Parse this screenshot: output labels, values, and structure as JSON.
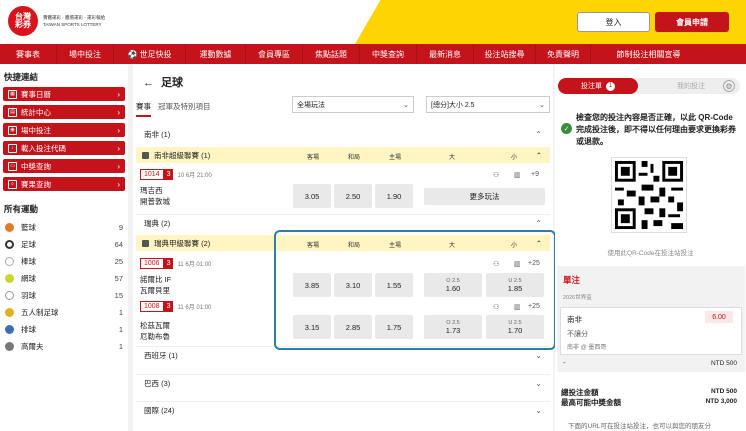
{
  "header": {
    "logo_mark": "台灣\n彩券",
    "logo_lines": [
      "實體運彩 · 體壇運彩 · 運彩報給",
      "TAIWAN SPORTS LOTTERY"
    ],
    "login_label": "登入",
    "register_label": "會員申請"
  },
  "nav": [
    "賽事表",
    "場中投注",
    "世足快投",
    "運動數據",
    "會員專區",
    "焦點話題",
    "中獎查詢",
    "最新消息",
    "投注站搜尋",
    "免責聲明",
    "節制投注相關宣導"
  ],
  "sidebar": {
    "quick_title": "快捷連結",
    "quick_links": [
      "賽事日曆",
      "統計中心",
      "場中投注",
      "載入投注代碼",
      "中獎查詢",
      "賽果查詢"
    ],
    "sports_title": "所有運動",
    "sports": [
      {
        "name": "籃球",
        "count": "9",
        "color": "#e07b27"
      },
      {
        "name": "足球",
        "count": "64",
        "color": "#333333"
      },
      {
        "name": "棒球",
        "count": "25",
        "color": "#bbbbbb"
      },
      {
        "name": "網球",
        "count": "57",
        "color": "#c8d630"
      },
      {
        "name": "羽球",
        "count": "15",
        "color": "#999999"
      },
      {
        "name": "五人制足球",
        "count": "1",
        "color": "#e0b020"
      },
      {
        "name": "排球",
        "count": "1",
        "color": "#3a6fb7"
      },
      {
        "name": "高爾夫",
        "count": "1",
        "color": "#777777"
      }
    ]
  },
  "main": {
    "back_arrow": "←",
    "title": "足球",
    "tab_active": "賽事",
    "tab_other": "冠軍及特別項目",
    "select_market": "全場玩法",
    "select_line": "[總分]大小 2.5",
    "col_headers": {
      "away": "客場",
      "draw": "和局",
      "home": "主場",
      "over": "大",
      "under": "小"
    },
    "region_south_africa": "南非 (1)",
    "league_sa": "南非超級聯賽 (1)",
    "match_sa": {
      "id": "1014",
      "num": "3",
      "time": "10 6月 21:00",
      "team_a": "瑪吉西",
      "team_b": "開普敦城",
      "odds": [
        "3.05",
        "2.50",
        "1.90"
      ],
      "more": "更多玩法",
      "plus": "+9"
    },
    "region_sweden": "瑞典 (2)",
    "league_se": "瑞典甲級聯賽 (2)",
    "match_se1": {
      "id": "1006",
      "num": "3",
      "time": "11 6月 01:00",
      "team_a": "諾爾比 IF",
      "team_b": "瓦爾貝里",
      "odds": [
        "3.85",
        "3.10",
        "1.55"
      ],
      "over_line": "O 2.5",
      "over": "1.60",
      "under_line": "U 2.5",
      "under": "1.85",
      "plus": "+25"
    },
    "match_se2": {
      "id": "1008",
      "num": "3",
      "time": "11 6月 01:00",
      "team_a": "松茲瓦爾",
      "team_b": "厄勒布魯",
      "odds": [
        "3.15",
        "2.85",
        "1.75"
      ],
      "over_line": "O 2.5",
      "over": "1.73",
      "under_line": "U 2.5",
      "under": "1.70",
      "plus": "+25"
    },
    "region_spain": "西班牙 (1)",
    "region_brazil": "巴西 (3)",
    "region_intl": "國際 (24)"
  },
  "right": {
    "tab_active": "投注單",
    "tab_count": "1",
    "tab_other": "我的投注",
    "notice": "檢查您的投注內容是否正確，以此 QR-Code 完成投注後，即不得以任何理由要求更換彩券或退款。",
    "qr_caption": "使用此QR-Code在投注站投注",
    "slip_title": "單注",
    "slip_sub": "2026世界盃",
    "pick_team": "南非",
    "pick_price": "6.00",
    "pick_market": "不讓分",
    "pick_match": "南非 @ 墨西哥",
    "slip_amount": "NTD 500",
    "total_label": "總投注金額",
    "total_value": "NTD 500",
    "max_label": "最高可能中獎金額",
    "max_value": "NTD 3,000",
    "footer": "下面的URL可在投注站投注，也可以與您的朋友分"
  },
  "colors": {
    "brand_red": "#c4131b",
    "accent_yellow": "#ffd400",
    "highlight_blue": "#2d7ea8"
  }
}
